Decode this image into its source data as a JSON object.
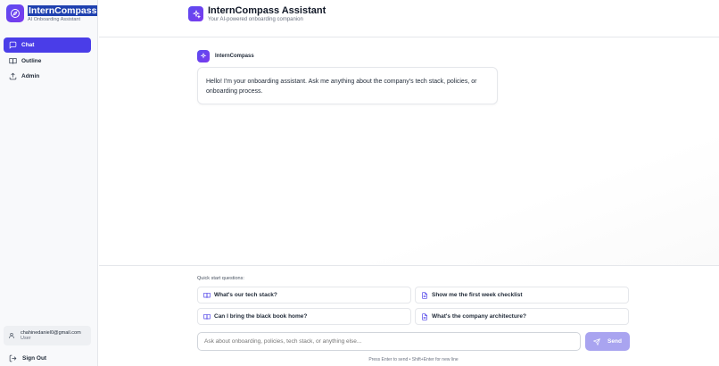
{
  "sidebar": {
    "brand_title": "InternCompass",
    "brand_subtitle": "AI Onboarding Assistant",
    "nav": [
      {
        "label": "Chat",
        "icon": "chat-icon",
        "active": true
      },
      {
        "label": "Outline",
        "icon": "book-icon",
        "active": false
      },
      {
        "label": "Admin",
        "icon": "upload-icon",
        "active": false
      }
    ],
    "user": {
      "email": "chahinedaniel0@gmail.com",
      "role": "User"
    },
    "sign_out_label": "Sign Out"
  },
  "header": {
    "title": "InternCompass Assistant",
    "subtitle": "Your AI-powered onboarding companion"
  },
  "chat": {
    "messages": [
      {
        "sender": "InternCompass",
        "text": "Hello! I'm your onboarding assistant. Ask me anything about the company's tech stack, policies, or onboarding process."
      }
    ]
  },
  "composer": {
    "quick_start_label": "Quick start questions:",
    "quick_questions": [
      {
        "label": "What's our tech stack?",
        "icon": "book-icon"
      },
      {
        "label": "Show me the first week checklist",
        "icon": "document-icon"
      },
      {
        "label": "Can I bring the black book home?",
        "icon": "book-icon"
      },
      {
        "label": "What's the company architecture?",
        "icon": "document-icon"
      }
    ],
    "input_placeholder": "Ask about onboarding, policies, tech stack, or anything else...",
    "send_label": "Send",
    "hint": "Press Enter to send • Shift+Enter for new line"
  },
  "colors": {
    "accent": "#4a3de8",
    "send_disabled": "#a9a4f0"
  }
}
